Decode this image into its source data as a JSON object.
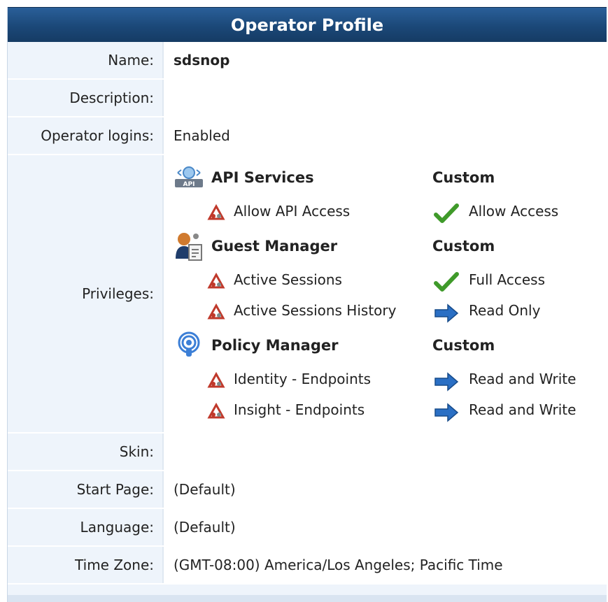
{
  "title": "Operator Profile",
  "fields": {
    "name_label": "Name:",
    "name_value": "sdsnop",
    "description_label": "Description:",
    "description_value": "",
    "operator_logins_label": "Operator logins:",
    "operator_logins_value": "Enabled",
    "privileges_label": "Privileges:",
    "skin_label": "Skin:",
    "skin_value": "",
    "start_page_label": "Start Page:",
    "start_page_value": "(Default)",
    "language_label": "Language:",
    "language_value": "(Default)",
    "time_zone_label": "Time Zone:",
    "time_zone_value": "(GMT-08:00) America/Los Angeles; Pacific Time"
  },
  "privileges": {
    "api_services": {
      "title": "API Services",
      "level": "Custom",
      "icon": "api-icon",
      "items": [
        {
          "label": "Allow API Access",
          "access": "Allow Access",
          "access_icon": "checkmark-icon"
        }
      ]
    },
    "guest_manager": {
      "title": "Guest Manager",
      "level": "Custom",
      "icon": "guest-manager-icon",
      "items": [
        {
          "label": "Active Sessions",
          "access": "Full Access",
          "access_icon": "checkmark-icon"
        },
        {
          "label": "Active Sessions History",
          "access": "Read Only",
          "access_icon": "arrow-right-icon"
        }
      ]
    },
    "policy_manager": {
      "title": "Policy Manager",
      "level": "Custom",
      "icon": "policy-manager-icon",
      "items": [
        {
          "label": "Identity - Endpoints",
          "access": "Read and Write",
          "access_icon": "arrow-right-icon"
        },
        {
          "label": "Insight - Endpoints",
          "access": "Read and Write",
          "access_icon": "arrow-right-icon"
        }
      ]
    }
  },
  "colors": {
    "header_bg": "#1b4878",
    "label_bg": "#eef4fb",
    "check_green": "#3f9a2a",
    "arrow_blue": "#2a6fc4"
  }
}
